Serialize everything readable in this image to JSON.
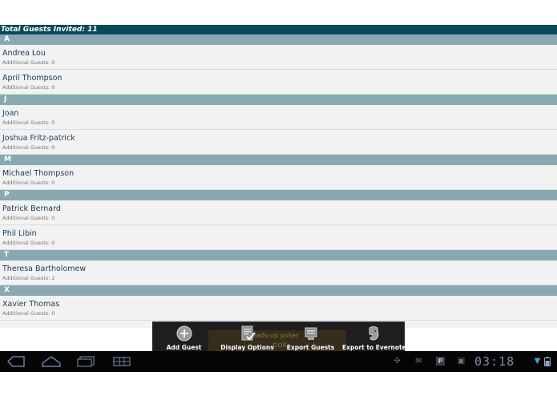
{
  "header": {
    "total_label": "Total Guests Invited: 11"
  },
  "sections": [
    {
      "letter": "A",
      "guests": [
        {
          "name": "Andrea Lou",
          "extra": "Additional Guests: 0"
        },
        {
          "name": "April Thompson",
          "extra": "Additional Guests: 0"
        }
      ]
    },
    {
      "letter": "J",
      "guests": [
        {
          "name": "Joan",
          "extra": "Additional Guests: 0"
        },
        {
          "name": "Joshua Fritz-patrick",
          "extra": "Additional Guests: 0"
        }
      ]
    },
    {
      "letter": "M",
      "guests": [
        {
          "name": "Michael Thompson",
          "extra": "Additional Guests: 0"
        }
      ]
    },
    {
      "letter": "P",
      "guests": [
        {
          "name": "Patrick Bernard",
          "extra": "Additional Guests: 0"
        },
        {
          "name": "Phil Libin",
          "extra": "Additional Guests: 0"
        }
      ]
    },
    {
      "letter": "T",
      "guests": [
        {
          "name": "Theresa Bartholomew",
          "extra": "Additional Guests: 2"
        }
      ]
    },
    {
      "letter": "X",
      "guests": [
        {
          "name": "Xavier Thomas",
          "extra": "Additional Guests: 0"
        }
      ]
    }
  ],
  "menu": {
    "items": [
      {
        "label": "Add Guest",
        "icon": "add-circle-icon"
      },
      {
        "label": "Display Options",
        "icon": "checklist-icon"
      },
      {
        "label": "Export Guests",
        "icon": "export-icon"
      },
      {
        "label": "Export to Evernote",
        "icon": "evernote-elephant-icon"
      }
    ],
    "ad_text_1": "heads-up poker",
    "ad_text_2": "pok"
  },
  "systembar": {
    "clock": "03:18",
    "nav_icons": [
      "back-icon",
      "home-icon",
      "recent-apps-icon",
      "menu-grid-icon"
    ],
    "status_icons": [
      "usb-icon",
      "mail-icon",
      "parking-icon",
      "briefcase-icon",
      "wifi-icon",
      "battery-icon"
    ]
  },
  "colors": {
    "header_bg": "#0b4a5c",
    "section_bg": "#89a8b2",
    "row_bg": "#f2f2f2",
    "name_text": "#1b3b55"
  }
}
